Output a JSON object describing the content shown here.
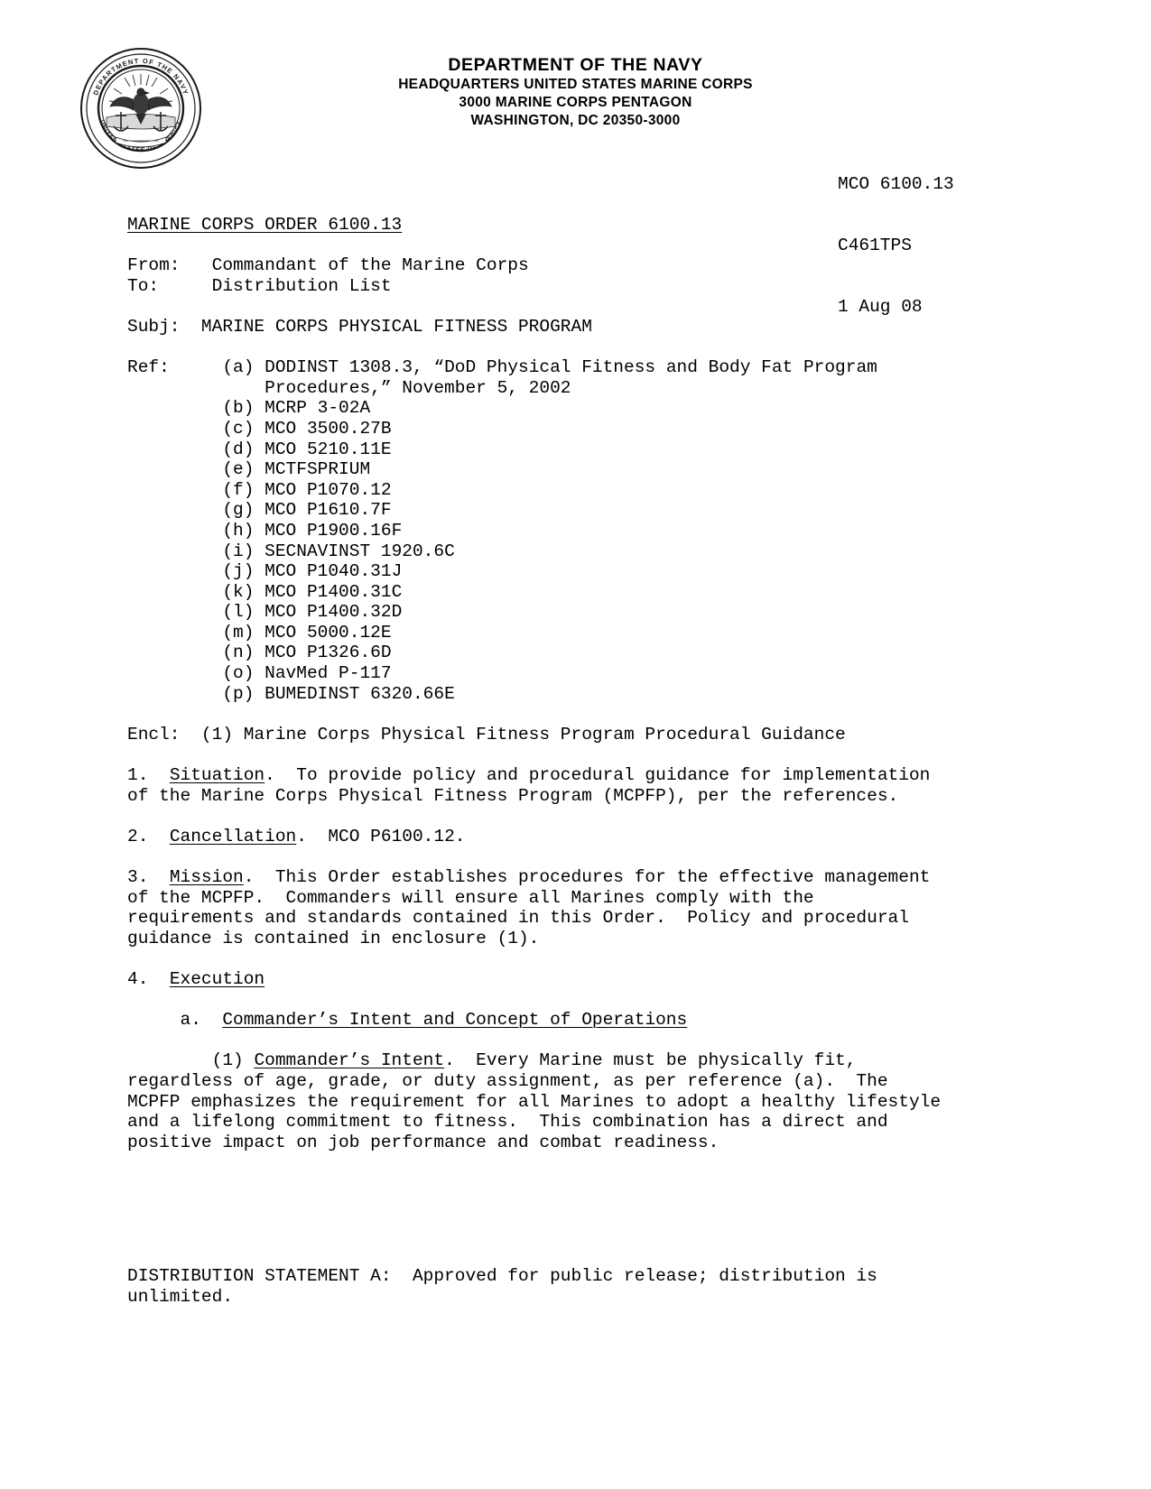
{
  "letterhead": {
    "line1": "DEPARTMENT OF THE NAVY",
    "line2": "HEADQUARTERS UNITED STATES MARINE CORPS",
    "line3": "3000 MARINE CORPS PENTAGON",
    "line4": "WASHINGTON, DC 20350-3000"
  },
  "seal": {
    "name": "department-of-the-navy-seal",
    "outer_text": "DEPARTMENT OF THE NAVY",
    "inner_text": "UNITED STATES OF AMERICA"
  },
  "identification": {
    "order_number": "MCO 6100.13",
    "code": "C461TPS",
    "date": "1 Aug 08"
  },
  "document": {
    "title": "MARINE CORPS ORDER 6100.13",
    "from_label": "From:",
    "from_value": "Commandant of the Marine Corps",
    "to_label": "To:",
    "to_value": "Distribution List",
    "subj_label": "Subj:",
    "subj_value": "MARINE CORPS PHYSICAL FITNESS PROGRAM",
    "ref_label": "Ref:",
    "encl_label": "Encl:",
    "encl_items": [
      {
        "marker": "(1)",
        "text": "Marine Corps Physical Fitness Program Procedural Guidance"
      }
    ]
  },
  "references": [
    {
      "marker": "(a)",
      "text": "DODINST 1308.3, “DoD Physical Fitness and Body Fat Program",
      "cont": "Procedures,” November 5, 2002"
    },
    {
      "marker": "(b)",
      "text": "MCRP 3-02A"
    },
    {
      "marker": "(c)",
      "text": "MCO 3500.27B"
    },
    {
      "marker": "(d)",
      "text": "MCO 5210.11E"
    },
    {
      "marker": "(e)",
      "text": "MCTFSPRIUM"
    },
    {
      "marker": "(f)",
      "text": "MCO P1070.12"
    },
    {
      "marker": "(g)",
      "text": "MCO P1610.7F"
    },
    {
      "marker": "(h)",
      "text": "MCO P1900.16F"
    },
    {
      "marker": "(i)",
      "text": "SECNAVINST 1920.6C"
    },
    {
      "marker": "(j)",
      "text": "MCO P1040.31J"
    },
    {
      "marker": "(k)",
      "text": "MCO P1400.31C"
    },
    {
      "marker": "(l)",
      "text": "MCO P1400.32D"
    },
    {
      "marker": "(m)",
      "text": "MCO 5000.12E"
    },
    {
      "marker": "(n)",
      "text": "MCO P1326.6D"
    },
    {
      "marker": "(o)",
      "text": "NavMed P-117"
    },
    {
      "marker": "(p)",
      "text": "BUMEDINST 6320.66E"
    }
  ],
  "paragraphs": {
    "p1": {
      "number": "1.",
      "heading": "Situation",
      "lines": [
        ".  To provide policy and procedural guidance for implementation",
        "of the Marine Corps Physical Fitness Program (MCPFP), per the references."
      ]
    },
    "p2": {
      "number": "2.",
      "heading": "Cancellation",
      "lines": [
        ".  MCO P6100.12."
      ]
    },
    "p3": {
      "number": "3.",
      "heading": "Mission",
      "lines": [
        ".  This Order establishes procedures for the effective management",
        "of the MCPFP.  Commanders will ensure all Marines comply with the",
        "requirements and standards contained in this Order.  Policy and procedural",
        "guidance is contained in enclosure (1)."
      ]
    },
    "p4": {
      "number": "4.",
      "heading": "Execution"
    },
    "p4a": {
      "marker": "a.",
      "heading": "Commander’s Intent and Concept of Operations"
    },
    "p4a1": {
      "marker": "(1)",
      "heading": "Commander’s Intent",
      "lines": [
        ".  Every Marine must be physically fit,",
        "regardless of age, grade, or duty assignment, as per reference (a).  The",
        "MCPFP emphasizes the requirement for all Marines to adopt a healthy lifestyle",
        "and a lifelong commitment to fitness.  This combination has a direct and",
        "positive impact on job performance and combat readiness."
      ]
    }
  },
  "footer": {
    "line1": "DISTRIBUTION STATEMENT A:  Approved for public release; distribution is",
    "line2": "unlimited."
  }
}
